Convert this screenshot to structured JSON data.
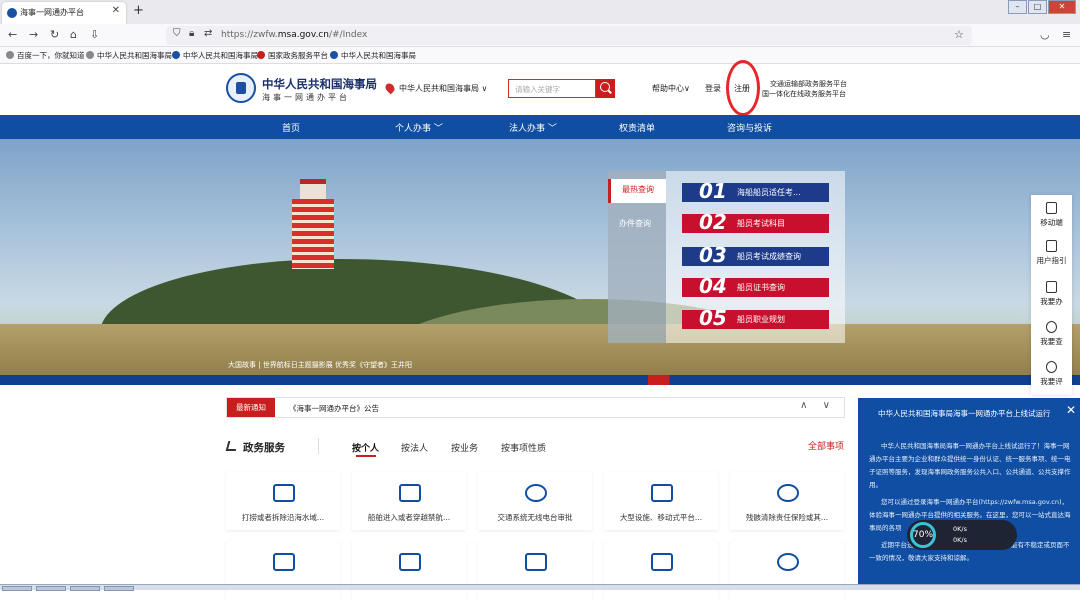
{
  "browser": {
    "tab_title": "海事一网通办平台",
    "new_tab": "+",
    "close_tab": "✕",
    "url_prefix": "https://zwfw.",
    "url_domain": "msa.gov.cn",
    "url_path": "/#/Index",
    "bookmarks": [
      "百度一下，你就知道",
      "中华人民共和国海事局",
      "中华人民共和国海事局",
      "国家政务服务平台",
      "中华人民共和国海事局"
    ]
  },
  "header": {
    "site_title": "中华人民共和国海事局",
    "site_subtitle": "海事一网通办平台",
    "location": "中华人民共和国海事局",
    "search_placeholder": "请输入关键字",
    "help": "帮助中心",
    "login": "登录",
    "register": "注册",
    "platform_line1": "交通运输部政务服务平台",
    "platform_line2": "国一体化在线政务服务平台"
  },
  "nav": {
    "items": [
      "首页",
      "个人办事",
      "法人办事",
      "权责清单",
      "咨询与投诉"
    ]
  },
  "banner": {
    "caption": "大国故事 | 世界航标日主题摄影展 优秀奖《守望者》王井阳"
  },
  "query_panel": {
    "tabs": [
      "最热查询",
      "办件查询"
    ],
    "items": [
      {
        "num": "01",
        "label": "海船船员适任考..."
      },
      {
        "num": "02",
        "label": "船员考试科目"
      },
      {
        "num": "03",
        "label": "船员考试成绩查询"
      },
      {
        "num": "04",
        "label": "船员证书查询"
      },
      {
        "num": "05",
        "label": "船员职业规划"
      }
    ]
  },
  "notice": {
    "badge": "最新通知",
    "text": "《海事一网通办平台》公告",
    "arrows": "∧ ∨"
  },
  "services": {
    "title": "政务服务",
    "tabs": [
      "按个人",
      "按法人",
      "按业务",
      "按事项性质"
    ],
    "all_items": "全部事项",
    "cards_row1": [
      "打捞或者拆除沿海水域...",
      "船舶进入或者穿越禁航...",
      "交通系统无线电台审批",
      "大型设施、移动式平台...",
      "残骸清除责任保险或其..."
    ]
  },
  "sidebar": {
    "items": [
      "移动端",
      "用户指引",
      "我要办",
      "我要查",
      "我要评"
    ]
  },
  "popup": {
    "title": "中华人民共和国海事局海事一网通办平台上线试运行",
    "close": "✕",
    "paragraphs": [
      "中华人民共和国海事局海事一网通办平台上线试运行了！海事一网通办平台主要为企业和群众提供统一身份认证、统一服务事项、统一电子证照等服务，发现海事网政务服务公共入口、公共通道、公共支撑作用。",
      "您可以通过登录海事一网通办平台(https://zwfw.msa.gov.cn)，体验海事一网通办平台提供的相关服务。在这里，您可以一站式直达海事局的各项",
      "近期平台进行调试和页面优化，访问过程中可能有不稳定或页面不一致的情况，敬请大家支持和谅解。"
    ]
  },
  "speed_widget": {
    "percent": "70%",
    "up": "0K/s",
    "down": "0K/s"
  }
}
